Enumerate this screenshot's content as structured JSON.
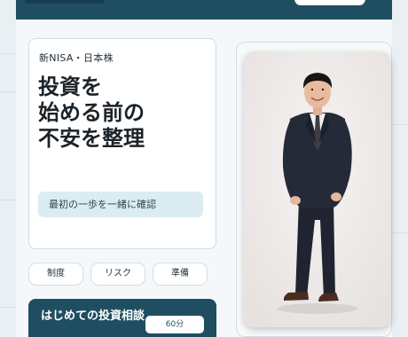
{
  "hero": {
    "eyebrow": "新NISA・日本株",
    "headline": "投資を\n始める前の\n不安を整理",
    "note": "最初の一歩を一緒に確認"
  },
  "tags": [
    "制度",
    "リスク",
    "準備"
  ],
  "consultation": {
    "title": "はじめての投資相談",
    "duration": "60分"
  },
  "colors": {
    "brand": "#1f4e62",
    "note_bg": "#dcecf3",
    "page_bg": "#e9eff2"
  }
}
